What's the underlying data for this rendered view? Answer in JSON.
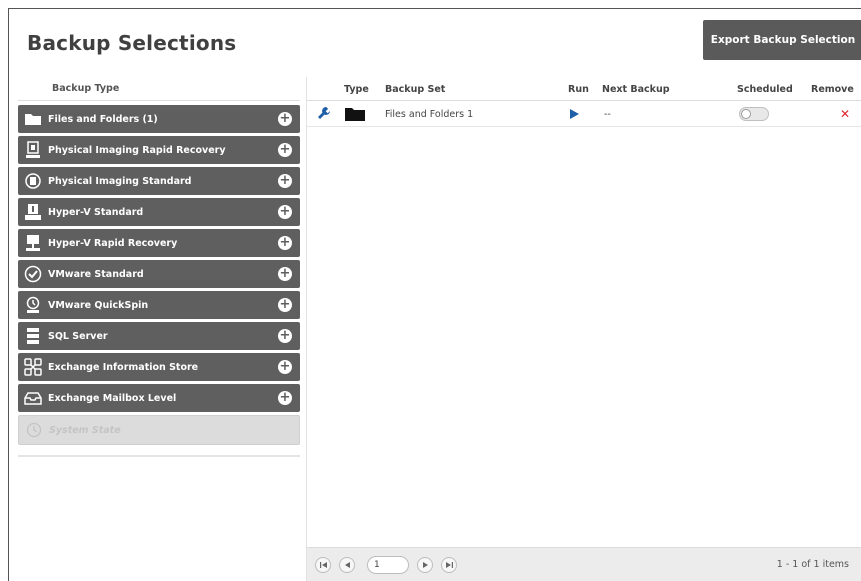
{
  "page": {
    "title": "Backup Selections"
  },
  "toolbar": {
    "export_label": "Export Backup Selection"
  },
  "left": {
    "header": "Backup Type",
    "items": [
      {
        "label": "Files and Folders (1)",
        "icon": "folder-icon"
      },
      {
        "label": "Physical Imaging Rapid Recovery",
        "icon": "server-rapid-icon"
      },
      {
        "label": "Physical Imaging Standard",
        "icon": "server-standard-icon"
      },
      {
        "label": "Hyper-V Standard",
        "icon": "hyperv-standard-icon"
      },
      {
        "label": "Hyper-V Rapid Recovery",
        "icon": "hyperv-rapid-icon"
      },
      {
        "label": "VMware Standard",
        "icon": "vmware-standard-icon"
      },
      {
        "label": "VMware QuickSpin",
        "icon": "vmware-quickspin-icon"
      },
      {
        "label": "SQL Server",
        "icon": "database-icon"
      },
      {
        "label": "Exchange Information Store",
        "icon": "exchange-store-icon"
      },
      {
        "label": "Exchange Mailbox Level",
        "icon": "mailbox-icon"
      }
    ],
    "disabled_item": {
      "label": "System State",
      "icon": "clock-icon"
    }
  },
  "grid": {
    "headers": {
      "type": "Type",
      "backup_set": "Backup Set",
      "run": "Run",
      "next_backup": "Next Backup",
      "scheduled": "Scheduled",
      "remove": "Remove"
    },
    "rows": [
      {
        "backup_set": "Files and Folders 1",
        "next_backup": "--",
        "scheduled": false
      }
    ]
  },
  "pager": {
    "page": "1",
    "info": "1 - 1 of 1 items"
  },
  "colors": {
    "item_bg": "#5f5f5f",
    "run": "#1f5fa8",
    "remove": "#e0262e",
    "edit": "#1f5fa8"
  }
}
